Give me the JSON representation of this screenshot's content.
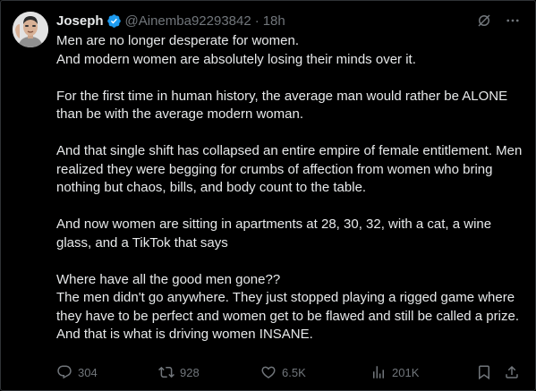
{
  "tweet": {
    "author": {
      "display_name": "Joseph",
      "verified": true,
      "handle": "@Ainemba92293842",
      "separator": "·",
      "timestamp": "18h"
    },
    "top_actions": [
      "grok-icon",
      "more-icon"
    ],
    "lines": {
      "l1": "Men are no longer desperate for women.",
      "l2": "And modern women are absolutely losing their minds over it.",
      "l3": "For the first time in human history, the average man would rather be ALONE than be with the average modern woman.",
      "l4": "And that single shift has collapsed an entire empire of female entitlement. Men realized they were begging for crumbs of affection from women who bring nothing but chaos, bills, and body count to the table.",
      "l5": "And now women are sitting in apartments at 28, 30, 32, with a cat, a wine glass, and a TikTok that says",
      "l6": "Where have all the good men gone??",
      "l7": "The men didn't go anywhere. They just stopped playing a rigged game where they have to be perfect and women get to be flawed and still be called a prize.",
      "l8": "And that is what is driving women INSANE."
    },
    "stats": {
      "replies": "304",
      "reposts": "928",
      "likes": "6.5K",
      "views": "201K"
    },
    "colors": {
      "background": "#000000",
      "text": "#e7e9ea",
      "muted": "#71767b",
      "verified_badge": "#1d9bf0",
      "border": "#2f3336"
    }
  }
}
